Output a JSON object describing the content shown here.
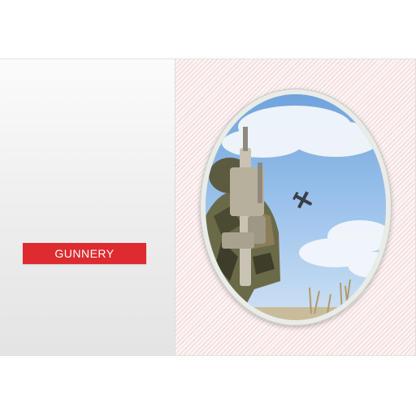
{
  "category": {
    "label": "GUNNERY"
  },
  "colors": {
    "accent": "#dd2b2f",
    "sky": "#9cc3ec"
  },
  "image": {
    "subject": "soldier-aiming-at-aircraft"
  }
}
